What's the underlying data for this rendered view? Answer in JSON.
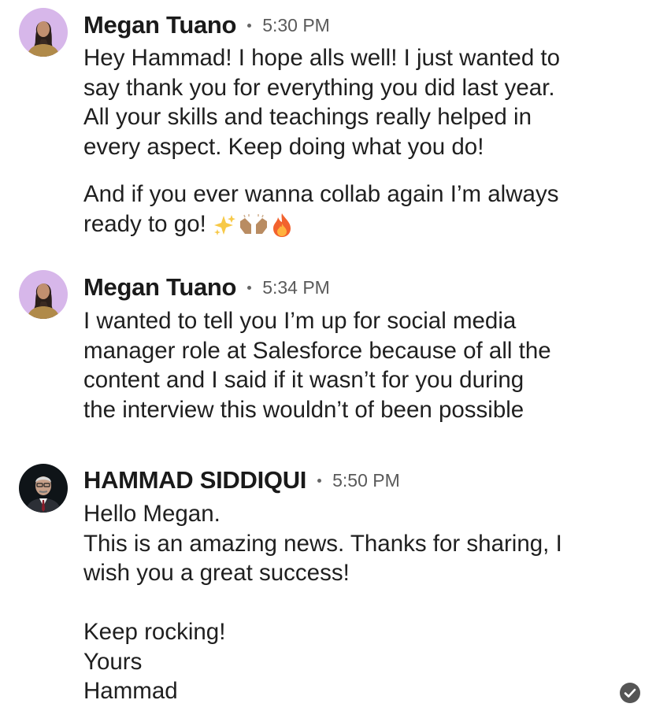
{
  "messages": [
    {
      "sender": "Megan Tuano",
      "time": "5:30 PM",
      "avatar": "megan-avatar",
      "paragraphs": [
        [
          "Hey Hammad! I hope alls well! I just wanted to",
          "say thank you for everything you did last year.",
          "All your skills and teachings really helped in",
          "every aspect. Keep doing what you do!"
        ],
        [
          "And if you ever wanna collab again I’m always",
          "ready to go!"
        ]
      ],
      "emojis": [
        "sparkles-icon",
        "raising-hands-icon",
        "fire-icon"
      ]
    },
    {
      "sender": "Megan Tuano",
      "time": "5:34 PM",
      "avatar": "megan-avatar",
      "paragraphs": [
        [
          "I wanted to tell you I’m up for social media",
          "manager role at Salesforce because of all the",
          "content and I said if it wasn’t for you during",
          "the interview this wouldn’t of been possible"
        ]
      ]
    },
    {
      "sender": "HAMMAD SIDDIQUI",
      "time": "5:50 PM",
      "avatar": "hammad-avatar",
      "paragraphs": [
        [
          "Hello Megan.",
          "This is an amazing news. Thanks for sharing, I",
          "wish you a great success!"
        ],
        [
          "Keep rocking!",
          "Yours",
          "Hammad"
        ]
      ]
    }
  ],
  "status": {
    "read_icon": "read-check-icon"
  },
  "colors": {
    "text": "#1f1f1f",
    "timestamp": "#5a5a5a",
    "check": "#555555"
  }
}
